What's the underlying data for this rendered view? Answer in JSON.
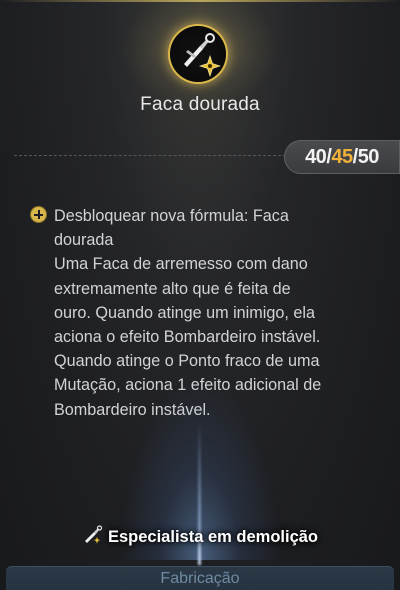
{
  "item": {
    "title": "Faca dourada",
    "icon": "throwing-knife-icon"
  },
  "counter": {
    "current": "40",
    "sep1": "/",
    "middle": "45",
    "sep2": "/",
    "max": "50"
  },
  "unlock": {
    "icon": "plus-circle-icon",
    "lines": [
      "Desbloquear nova fórmula: Faca",
      "dourada",
      "Uma Faca de arremesso com dano",
      "extremamente alto que é feita de",
      "ouro. Quando atinge um inimigo, ela",
      "aciona o efeito Bombardeiro instável.",
      "Quando atinge o Ponto fraco de uma",
      "Mutação, aciona 1 efeito adicional de",
      "Bombardeiro instável."
    ]
  },
  "specialization": {
    "label": "Especialista em demolição",
    "icon": "throwing-knife-icon"
  },
  "footer": {
    "label": "Fabricação"
  },
  "colors": {
    "accent_gold": "#d9b74a",
    "counter_highlight": "#f2b23a",
    "footer_text": "#6f8aa4"
  }
}
